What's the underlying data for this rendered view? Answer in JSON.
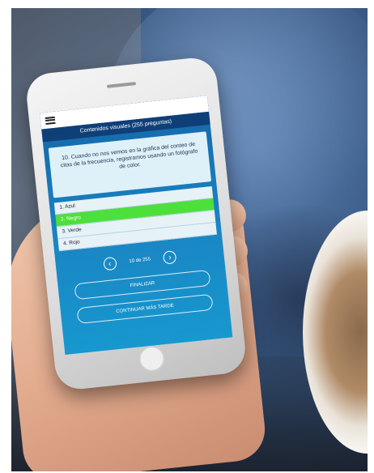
{
  "app": {
    "header_title": "Contenidos visuales (255 preguntas)"
  },
  "question": {
    "text": "10. Cuando no nos vemos en la gráfica del conteo de citas de la frecuencia, registramos usando un fotógrafo de color."
  },
  "answers": [
    {
      "label": "1. Azul",
      "selected": false
    },
    {
      "label": "2. Negro",
      "selected": true
    },
    {
      "label": "3. Verde",
      "selected": false
    },
    {
      "label": "4. Rojo",
      "selected": false
    }
  ],
  "navigation": {
    "counter": "10 de 255",
    "prev_icon": "chevron-left-icon",
    "next_icon": "chevron-right-icon"
  },
  "buttons": {
    "finalize": "FINALIZAR",
    "continue_later": "CONTINUAR MÁS TARDE"
  },
  "colors": {
    "selected_answer": "#4ee03a",
    "title_bar": "#0f3f77",
    "screen_bg": "#1a86c4"
  }
}
